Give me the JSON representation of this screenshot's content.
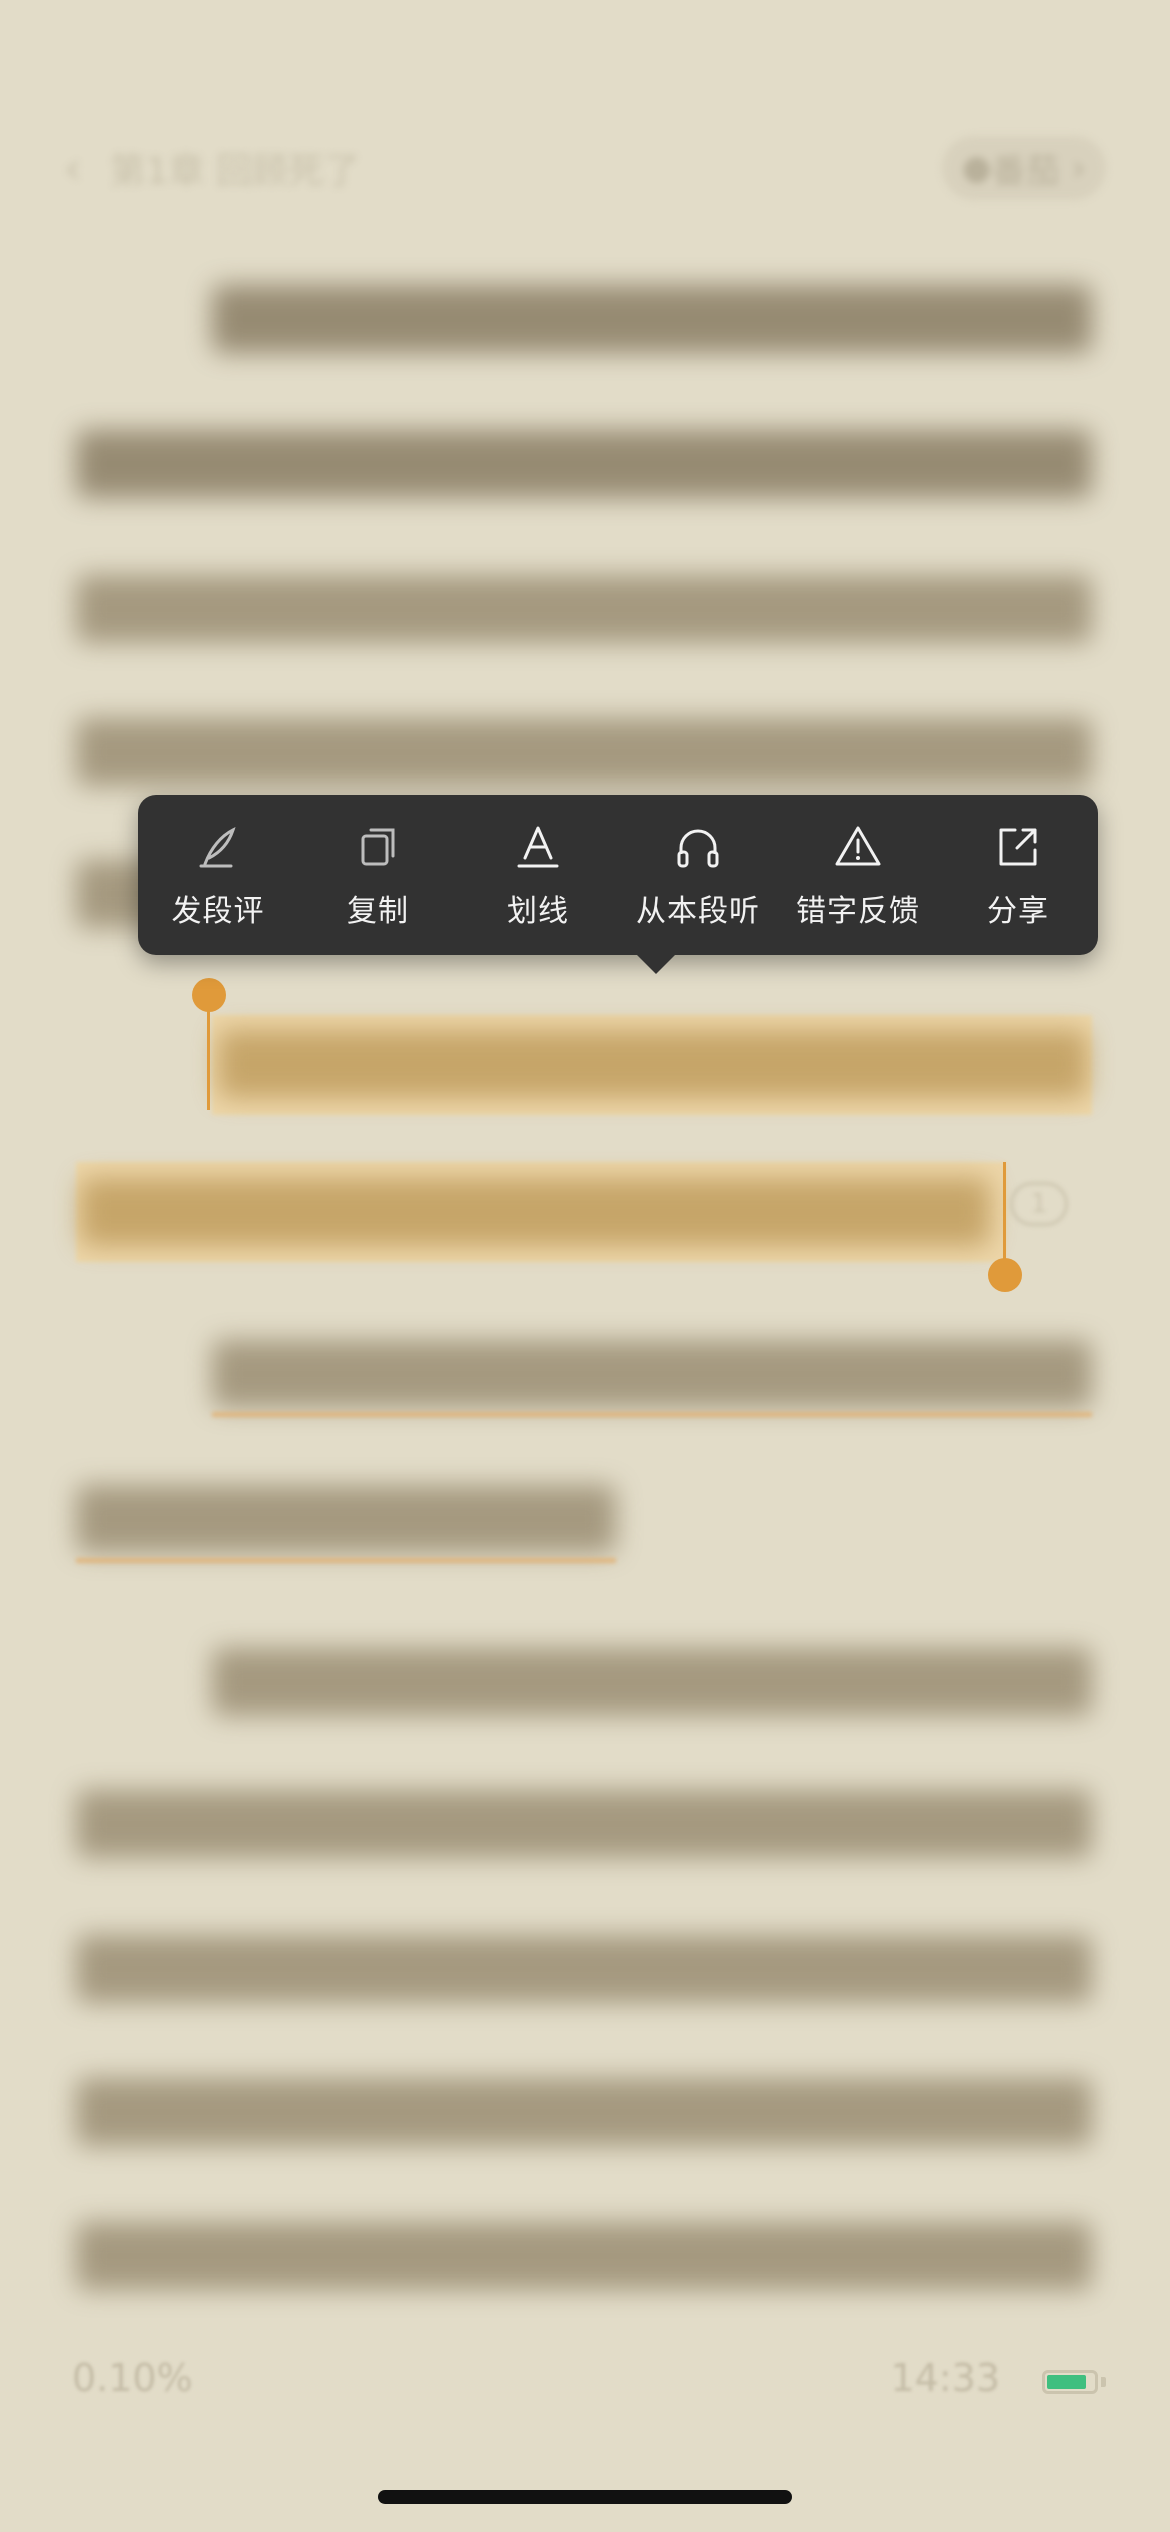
{
  "header": {
    "back_icon": "chevron-left-icon",
    "chapter_title": "第1章 回顾死了",
    "source_label": "番茄",
    "source_icon": "tomato-icon",
    "forward_icon": "chevron-right-icon"
  },
  "selection_menu": {
    "items": [
      {
        "label": "发段评",
        "icon": "quill-icon"
      },
      {
        "label": "复制",
        "icon": "copy-icon"
      },
      {
        "label": "划线",
        "icon": "underline-icon"
      },
      {
        "label": "从本段听",
        "icon": "headphones-icon"
      },
      {
        "label": "错字反馈",
        "icon": "warning-icon"
      },
      {
        "label": "分享",
        "icon": "share-icon"
      }
    ]
  },
  "selection": {
    "comment_count": "1"
  },
  "footer": {
    "progress": "0.10%",
    "time": "14:33",
    "battery_level": 0.85,
    "battery_color": "#3fbf7f"
  },
  "colors": {
    "background": "#e2dcc8",
    "accent": "#e09a3a",
    "menu_bg": "#323232"
  }
}
